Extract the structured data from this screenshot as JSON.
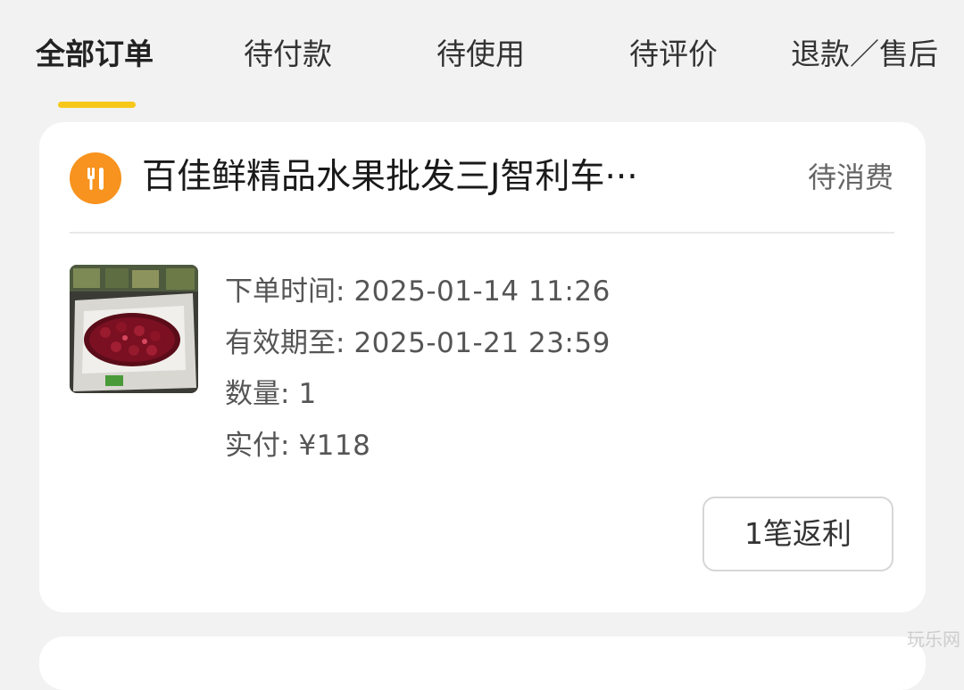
{
  "tabs": [
    {
      "label": "全部订单",
      "active": true
    },
    {
      "label": "待付款",
      "active": false
    },
    {
      "label": "待使用",
      "active": false
    },
    {
      "label": "待评价",
      "active": false
    },
    {
      "label": "退款／售后",
      "active": false
    }
  ],
  "colors": {
    "accent": "#f7c81a",
    "shop_icon_bg": "#f7931e",
    "background": "#f2f2f2"
  },
  "order": {
    "shop_icon": "restaurant-icon",
    "shop_name": "百佳鲜精品水果批发三J智利车···",
    "status": "待消费",
    "product_image": "cherries-box-image",
    "details": [
      {
        "label": "下单时间:",
        "value": "2025-01-14  11:26"
      },
      {
        "label": "有效期至:",
        "value": "2025-01-21  23:59"
      },
      {
        "label": "数量:",
        "value": "1"
      },
      {
        "label": "实付:",
        "value": "¥118"
      }
    ],
    "action_label": "1笔返利"
  },
  "watermark": "玩乐网"
}
